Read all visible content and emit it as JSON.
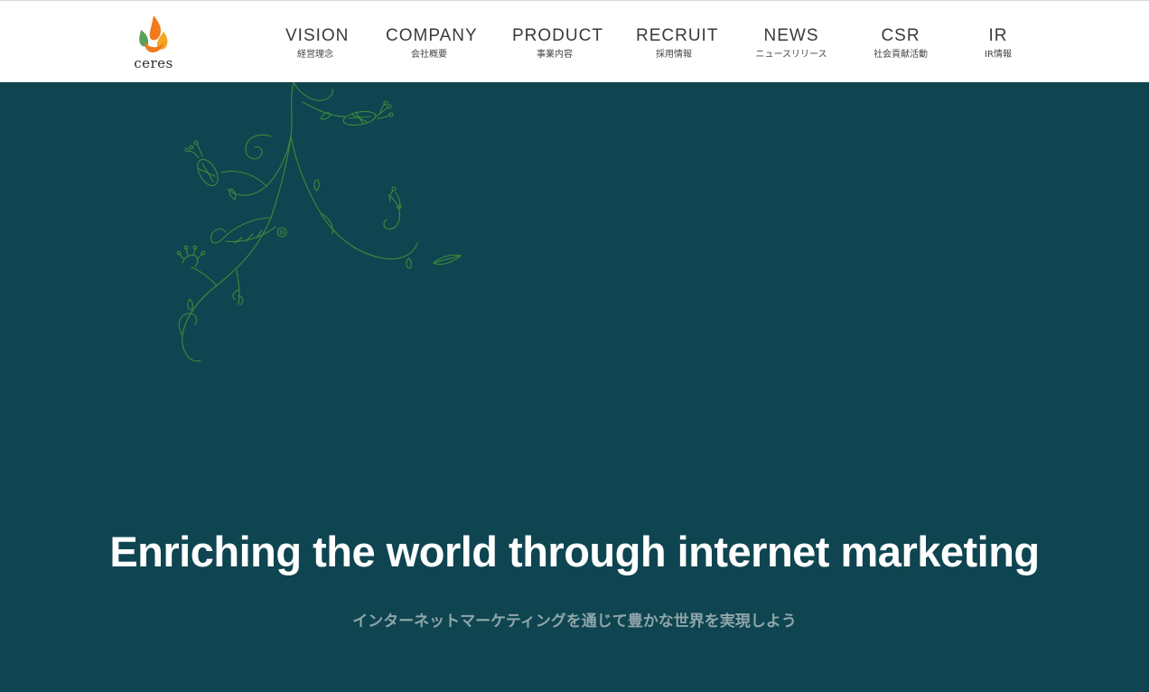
{
  "brand": {
    "name": "ceres",
    "colors": {
      "flame_orange": "#f07a1d",
      "flame_yellow": "#f5a623",
      "flame_green": "#5aa05a"
    }
  },
  "nav": {
    "items": [
      {
        "en": "VISION",
        "ja": "経営理念"
      },
      {
        "en": "COMPANY",
        "ja": "会社概要"
      },
      {
        "en": "PRODUCT",
        "ja": "事業内容"
      },
      {
        "en": "RECRUIT",
        "ja": "採用情報"
      },
      {
        "en": "NEWS",
        "ja": "ニュースリリース"
      },
      {
        "en": "CSR",
        "ja": "社会貢献活動"
      },
      {
        "en": "IR",
        "ja": "IR情報"
      }
    ]
  },
  "hero": {
    "headline": "Enriching the world through internet marketing",
    "subline": "インターネットマーケティングを通じて豊かな世界を実現しよう",
    "colors": {
      "background": "#0f4550",
      "vine": "#3d8a3a"
    }
  }
}
